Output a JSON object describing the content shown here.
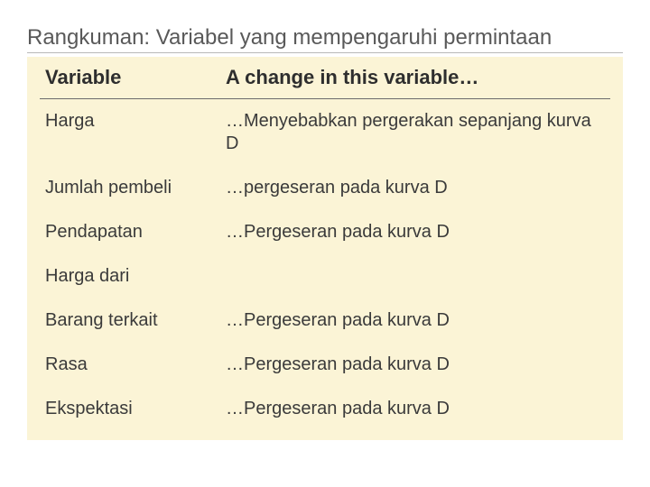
{
  "title": "Rangkuman: Variabel yang mempengaruhi permintaan",
  "headers": {
    "variable": "Variable",
    "change": "A change in this variable…"
  },
  "rows": [
    {
      "variable": "Harga",
      "change": "…Menyebabkan pergerakan sepanjang kurva D"
    },
    {
      "variable": "Jumlah pembeli",
      "change": "…pergeseran pada kurva D"
    },
    {
      "variable": "Pendapatan",
      "change": "…Pergeseran pada kurva D"
    },
    {
      "variable": "Harga dari",
      "change": ""
    },
    {
      "variable": "Barang terkait",
      "change": "…Pergeseran pada kurva D"
    },
    {
      "variable": "Rasa",
      "change": "…Pergeseran pada kurva D"
    },
    {
      "variable": "Ekspektasi",
      "change": "…Pergeseran pada kurva D"
    }
  ]
}
